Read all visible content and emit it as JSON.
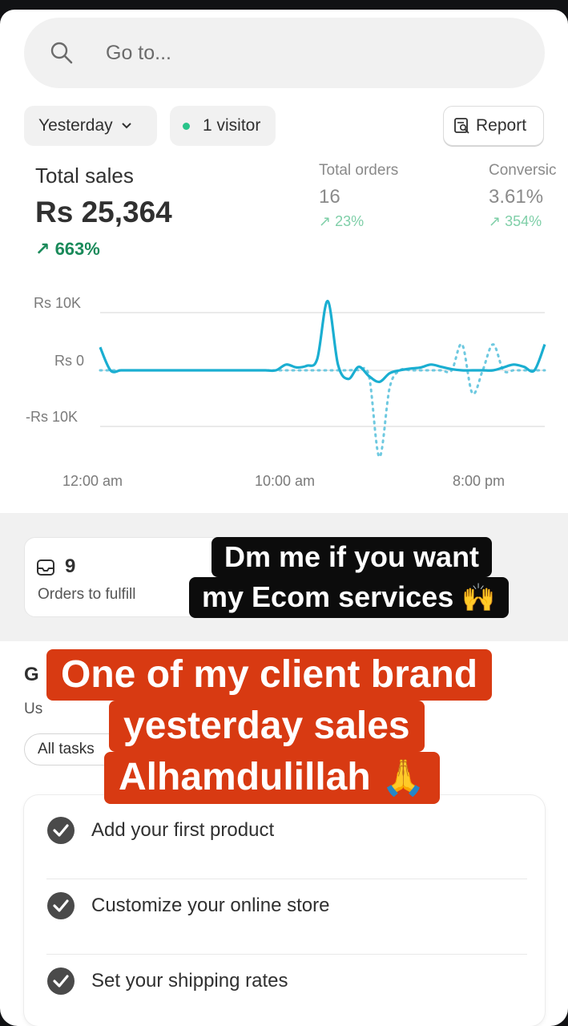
{
  "search": {
    "placeholder": "Go to..."
  },
  "filters": {
    "date": "Yesterday",
    "visitors": "1 visitor",
    "report": "Report"
  },
  "metrics": {
    "total_sales": {
      "label": "Total sales",
      "value": "Rs 25,364",
      "change": "663%"
    },
    "total_orders": {
      "label": "Total orders",
      "value": "16",
      "change": "23%"
    },
    "conversion": {
      "label": "Conversic",
      "value": "3.61%",
      "change": "354%"
    }
  },
  "chart_data": {
    "type": "line",
    "title": "",
    "xlabel": "",
    "ylabel": "",
    "x_ticks": [
      "12:00 am",
      "10:00 am",
      "8:00 pm"
    ],
    "y_ticks": [
      "Rs 10K",
      "Rs 0",
      "-Rs 10K"
    ],
    "ylim": [
      -15000,
      10000
    ],
    "grid": true,
    "series": [
      {
        "values": [
          4000,
          0,
          0,
          0,
          0,
          0,
          0,
          0,
          0,
          0,
          0,
          0,
          0,
          0,
          0,
          0,
          0,
          0,
          1000,
          500,
          800,
          2000,
          12000,
          1000,
          -1500,
          600,
          -1000,
          -2000,
          -500,
          0,
          300,
          500,
          1000,
          600,
          200,
          0,
          0,
          0,
          0,
          500,
          1000,
          600,
          0,
          4500
        ],
        "color": "#1aaed1",
        "style": "solid"
      },
      {
        "values": [
          0,
          0,
          0,
          0,
          0,
          0,
          0,
          0,
          0,
          0,
          0,
          0,
          0,
          0,
          0,
          0,
          0,
          0,
          0,
          0,
          0,
          0,
          0,
          0,
          0,
          0,
          -1000,
          -15000,
          -3000,
          0,
          0,
          0,
          0,
          0,
          0,
          4500,
          -4000,
          0,
          4500,
          0,
          0,
          0,
          0,
          0
        ],
        "color": "#6ec9e0",
        "style": "dotted"
      }
    ],
    "colors": {
      "primary": "#1aaed1",
      "comparison": "#6ec9e0"
    }
  },
  "fulfill": {
    "count": "9",
    "label": "Orders to fulfill"
  },
  "getting_started": {
    "title_partial": "G",
    "subtitle_partial": "Us",
    "all_tasks": "All tasks"
  },
  "tasks": [
    {
      "label": "Add your first product"
    },
    {
      "label": "Customize your online store"
    },
    {
      "label": "Set your shipping rates"
    }
  ],
  "overlays": {
    "dm_line1": "Dm me if you want",
    "dm_line2": "my Ecom services",
    "dm_emoji": "🙌",
    "red_line1": "One of my client brand",
    "red_line2": "yesterday sales",
    "red_line3": "Alhamdulillah",
    "red_emoji": "🙏"
  }
}
